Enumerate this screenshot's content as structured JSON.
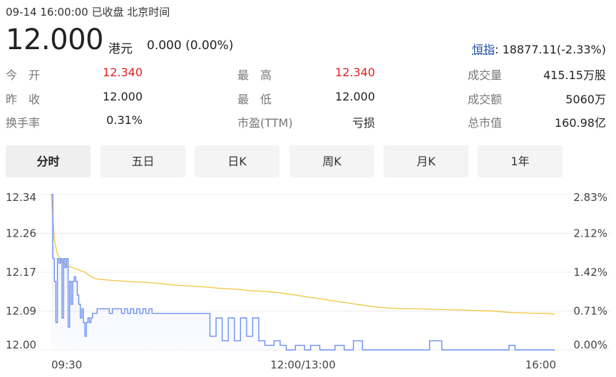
{
  "header": {
    "status": "09-14 16:00:00  已收盘  北京时间",
    "price": "12.000",
    "currency": "港元",
    "change": "0.000 (0.00%)",
    "index_name": "恒指",
    "index_value": ": 18877.11(-2.33%)"
  },
  "stats": {
    "open_label": "今　开",
    "open": "12.340",
    "prev_close_label": "昨　收",
    "prev_close": "12.000",
    "turnover_rate_label": "换手率",
    "turnover_rate": "0.31%",
    "high_label": "最　高",
    "high": "12.340",
    "low_label": "最　低",
    "low": "12.000",
    "pe_label": "市盈(TTM)",
    "pe": "亏损",
    "volume_label": "成交量",
    "volume": "415.15万股",
    "amount_label": "成交额",
    "amount": "5060万",
    "market_cap_label": "总市值",
    "market_cap": "160.98亿"
  },
  "tabs": [
    "分时",
    "五日",
    "日K",
    "周K",
    "月K",
    "1年"
  ],
  "active_tab": "分时",
  "colors": {
    "price_line": "#6d8ff0",
    "avg_line": "#f0c84a",
    "up": "#e02020",
    "index_link": "#1a4fa3"
  },
  "chart_data": {
    "type": "line",
    "y_ticks": [
      "12.34",
      "12.26",
      "12.17",
      "12.09",
      "12.00"
    ],
    "y_right_ticks": [
      "2.83%",
      "2.12%",
      "1.42%",
      "0.71%",
      "0.00%"
    ],
    "x_ticks": [
      "09:30",
      "12:00/13:00",
      "16:00"
    ],
    "ylim": [
      12.0,
      12.34
    ],
    "xlim": [
      0,
      330
    ],
    "series": [
      {
        "key": "price",
        "x": [
          0,
          1,
          2,
          3,
          4,
          5,
          6,
          7,
          8,
          9,
          10,
          11,
          12,
          13,
          14,
          15,
          16,
          17,
          18,
          19,
          20,
          21,
          22,
          23,
          24,
          25,
          26,
          27,
          28,
          29,
          30,
          32,
          34,
          36,
          38,
          40,
          42,
          44,
          46,
          48,
          50,
          52,
          54,
          56,
          58,
          60,
          62,
          64,
          66,
          68,
          70,
          72,
          74,
          76,
          78,
          80,
          84,
          88,
          92,
          96,
          100,
          104,
          108,
          112,
          116,
          120,
          124,
          128,
          132,
          136,
          140,
          146,
          150,
          154,
          160,
          166,
          170,
          176,
          180,
          186,
          192,
          198,
          204,
          208,
          212,
          216,
          220,
          230,
          240,
          244,
          248,
          256,
          264,
          270,
          274,
          278,
          286,
          296,
          300,
          304,
          310,
          318,
          322,
          326,
          330
        ],
        "y": [
          12.34,
          12.2,
          12.15,
          12.06,
          12.2,
          12.19,
          12.2,
          12.07,
          12.2,
          12.18,
          12.2,
          12.05,
          12.15,
          12.1,
          12.15,
          12.16,
          12.15,
          12.12,
          12.1,
          12.07,
          12.09,
          12.06,
          12.03,
          12.06,
          12.07,
          12.06,
          12.07,
          12.08,
          12.08,
          12.08,
          12.09,
          12.09,
          12.09,
          12.09,
          12.08,
          12.09,
          12.09,
          12.09,
          12.08,
          12.09,
          12.08,
          12.09,
          12.08,
          12.09,
          12.08,
          12.09,
          12.08,
          12.09,
          12.08,
          12.08,
          12.08,
          12.08,
          12.08,
          12.08,
          12.08,
          12.08,
          12.08,
          12.08,
          12.08,
          12.08,
          12.08,
          12.03,
          12.07,
          12.02,
          12.07,
          12.02,
          12.07,
          12.03,
          12.07,
          12.02,
          12.01,
          12.02,
          12.01,
          12.0,
          12.01,
          12.0,
          12.01,
          12.0,
          12.0,
          12.01,
          12.0,
          12.02,
          12.0,
          12.0,
          12.0,
          12.0,
          12.0,
          12.0,
          12.0,
          12.0,
          12.02,
          12.0,
          12.0,
          12.0,
          12.0,
          12.0,
          12.0,
          12.0,
          12.01,
          12.0,
          12.0,
          12.0,
          12.0,
          12.0,
          12.0
        ]
      },
      {
        "key": "avg",
        "x": [
          0,
          2,
          4,
          6,
          8,
          10,
          14,
          18,
          22,
          26,
          30,
          40,
          50,
          60,
          70,
          80,
          90,
          100,
          110,
          120,
          130,
          140,
          150,
          160,
          170,
          180,
          190,
          200,
          210,
          220,
          230,
          240,
          250,
          260,
          270,
          280,
          290,
          300,
          310,
          320,
          326,
          330
        ],
        "y": [
          12.34,
          12.24,
          12.21,
          12.2,
          12.19,
          12.185,
          12.18,
          12.175,
          12.17,
          12.16,
          12.155,
          12.152,
          12.15,
          12.148,
          12.146,
          12.142,
          12.14,
          12.138,
          12.135,
          12.133,
          12.13,
          12.128,
          12.125,
          12.12,
          12.115,
          12.11,
          12.105,
          12.1,
          12.095,
          12.092,
          12.09,
          12.09,
          12.089,
          12.088,
          12.087,
          12.086,
          12.085,
          12.082,
          12.081,
          12.08,
          12.08,
          12.078
        ]
      }
    ]
  }
}
